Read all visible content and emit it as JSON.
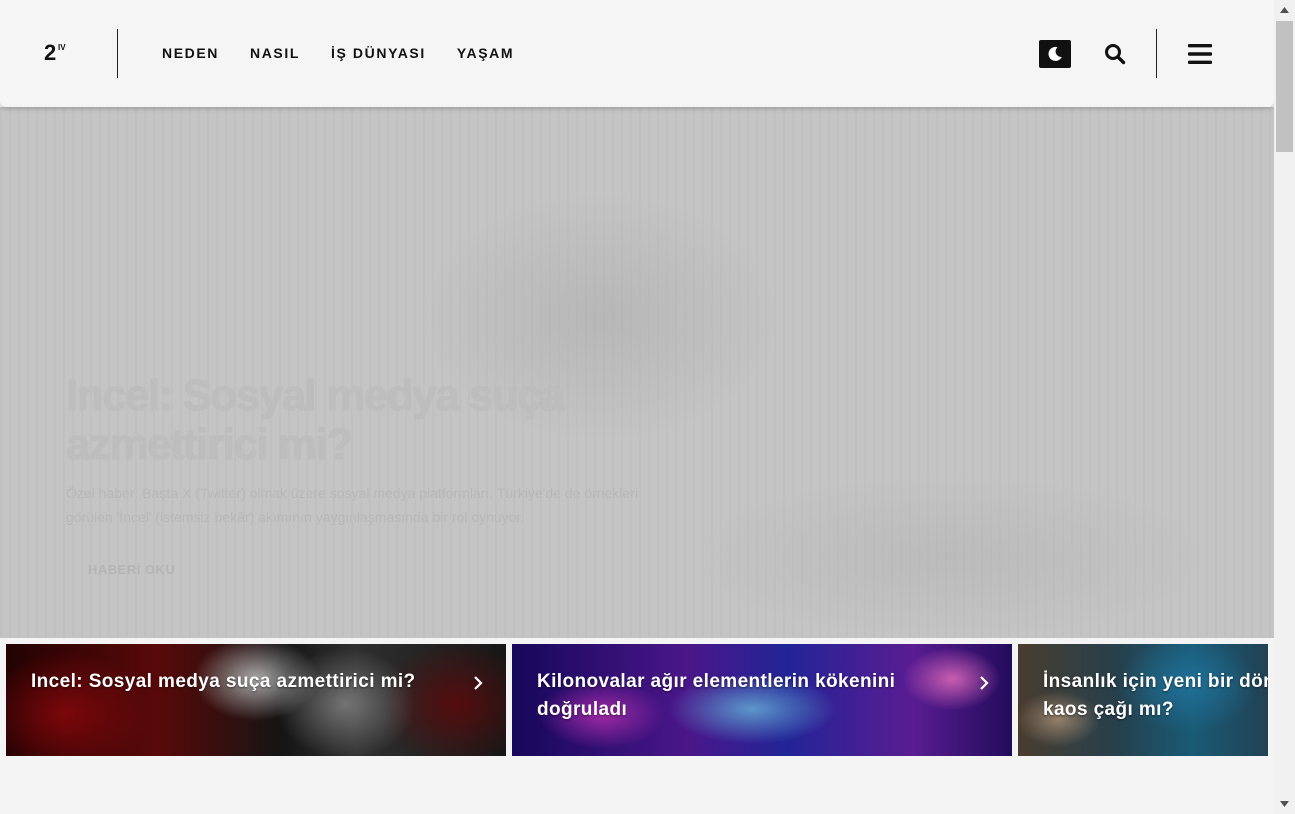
{
  "header": {
    "logo_text": "2",
    "logo_sup": "IV",
    "nav": [
      "NEDEN",
      "NASIL",
      "İŞ DÜNYASI",
      "YAŞAM"
    ]
  },
  "icons": {
    "theme_toggle": "moon-icon",
    "search": "search-icon",
    "menu": "hamburger-menu-icon"
  },
  "hero": {
    "title": "Incel: Sosyal medya suça azmettirici mi?",
    "description": "Özel haber: Başta X (Twitter) olmak üzere sosyal medya platformları, Türkiye'de de örnekleri görülen 'İncel' (istemsiz bekâr) akımının yaygınlaşmasında bir rol oynuyor.",
    "cta": "HABERİ OKU"
  },
  "cards": [
    {
      "title": "Incel: Sosyal medya suça azmettirici mi?"
    },
    {
      "title": "Kilonovalar ağır elementlerin kökenini doğruladı"
    },
    {
      "title_line1": "İnsanlık için yeni bir dönem:",
      "title_line2": "kaos çağı mı?"
    }
  ],
  "colors": {
    "background": "#f4f4f4",
    "header_bg": "#f5f5f5",
    "hero_overlay": "#c4c4c4",
    "text_dark": "#111111"
  }
}
